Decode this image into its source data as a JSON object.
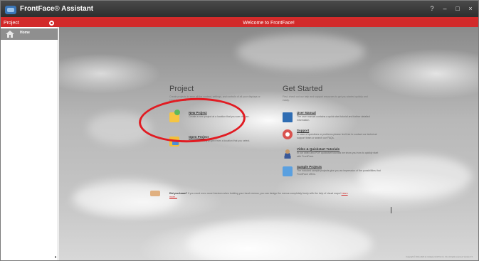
{
  "window": {
    "title_brand": "FrontFace",
    "title_reg": "®",
    "title_rest": " Assistant",
    "controls": {
      "help": "?",
      "minimize": "–",
      "maximize": "□",
      "close": "×"
    }
  },
  "subheader": {
    "project_label": "Project",
    "welcome": "Welcome to FrontFace!"
  },
  "sidebar": {
    "items": [
      {
        "label": "Home"
      }
    ]
  },
  "project": {
    "title": "Project",
    "subtitle": "Create projects to save all the content, settings, and controls of all your displays or kiosk terminals.",
    "items": [
      {
        "title": "New Project",
        "desc": "Create a new project at a location that you can choose."
      },
      {
        "title": "Open Project",
        "desc": "Open an existing project from a location that you select."
      }
    ]
  },
  "get_started": {
    "title": "Get Started",
    "subtitle": "First, check out our help and support resources to get you started quickly and easily.",
    "items": [
      {
        "title": "User Manual",
        "desc": "The user manual contains a quick start tutorial and further detailed information."
      },
      {
        "title": "Support",
        "desc": "In case of questions or problems please feel free to contact our technical support team or search our FAQs."
      },
      {
        "title": "Video & Quickstart Tutorials",
        "desc": "In our video and PDF quickstart tutorials we show you how to quickly start with FrontFace."
      },
      {
        "title": "Sample Projects",
        "desc": "The included sample projects give you an impression of the possibilities that FrontFace offers."
      }
    ]
  },
  "tip": {
    "lead": "Did you know?",
    "text": " If you need even more freedom when building your touch menus, you can design the menus completely freely with the help of visual maps! ",
    "link": "Learn more..."
  },
  "footer": {
    "copyright": "Copyright © 2011-2020 by mirabyte GmbH & Co. KG. All rights reserved.  Version 3.5"
  },
  "colors": {
    "accent": "#d22a2a",
    "titlebar": "#2e2e2e",
    "annotation": "#e11b22"
  }
}
